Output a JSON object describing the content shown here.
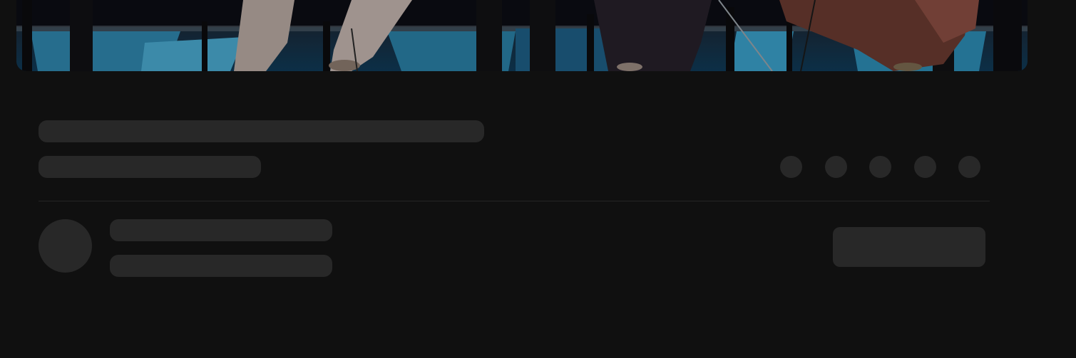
{
  "video": {
    "description_icon": "video-frame",
    "state": "loading"
  },
  "skeleton": {
    "state": "loading",
    "action_count": 5
  },
  "colors": {
    "background": "#101010",
    "skeleton": "#282828",
    "divider": "#262626"
  }
}
